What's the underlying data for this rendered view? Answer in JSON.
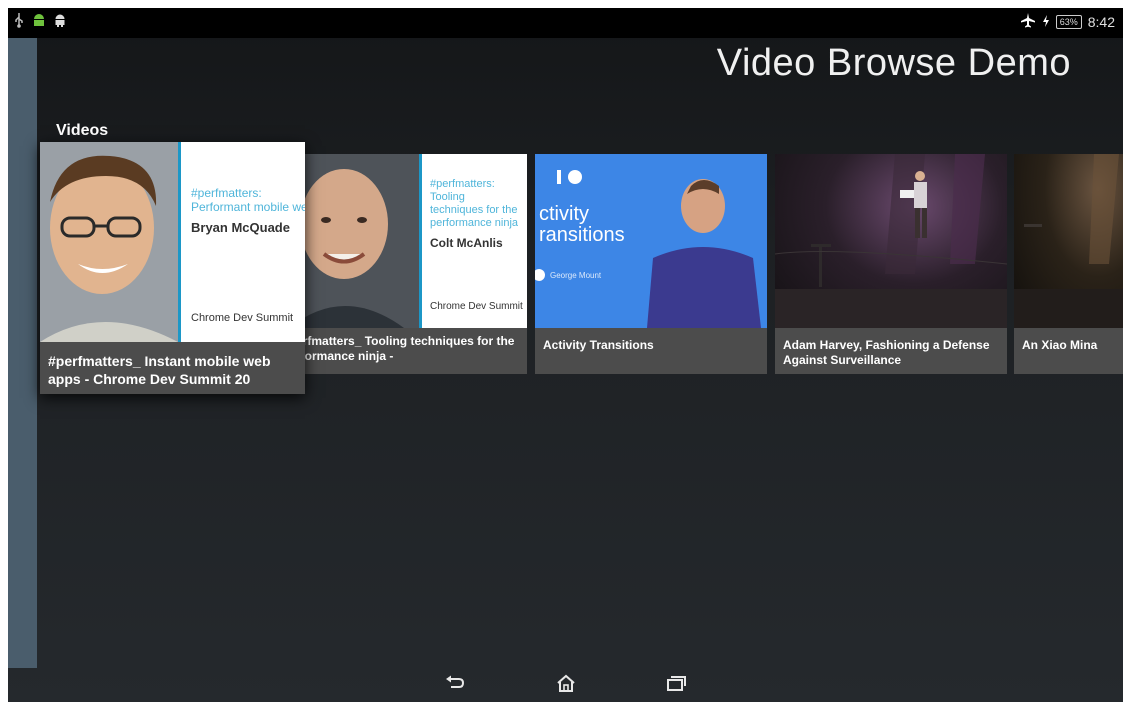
{
  "status_bar": {
    "left_icons": [
      "usb-icon",
      "android-notification-icon",
      "android-debug-icon"
    ],
    "right_icons": [
      "airplane-mode-icon",
      "charging-icon"
    ],
    "battery": "63%",
    "time": "8:42"
  },
  "app": {
    "title": "Video Browse Demo",
    "row_header": "Videos"
  },
  "videos": [
    {
      "title": "#perfmatters_ Instant mobile web apps - Chrome Dev Summit 20",
      "slide_hashtag": "#perfmatters:",
      "slide_subtitle": "Performant mobile we",
      "slide_speaker": "Bryan McQuade",
      "slide_footer": "Chrome Dev Summit"
    },
    {
      "title": "#perfmatters_ Tooling techniques for the performance ninja -",
      "slide_hashtag": "#perfmatters:",
      "slide_subtitle": "Tooling techniques for the performance ninja",
      "slide_speaker": "Colt McAnlis",
      "slide_footer": "Chrome Dev Summit"
    },
    {
      "title": "Activity Transitions",
      "slide_heading": "ctivity ransitions",
      "slide_speaker": "George Mount"
    },
    {
      "title": "Adam Harvey, Fashioning a Defense Against Surveillance"
    },
    {
      "title": "An Xiao Mina"
    }
  ],
  "nav_bar": {
    "icons": [
      "back-icon",
      "home-icon",
      "recents-icon"
    ]
  },
  "colors": {
    "background": "#1d2023",
    "card": "#4c4c4c",
    "side_strip": "#4a5d6c",
    "slide_accent": "#1c97c7",
    "io_blue": "#3d86e6"
  }
}
